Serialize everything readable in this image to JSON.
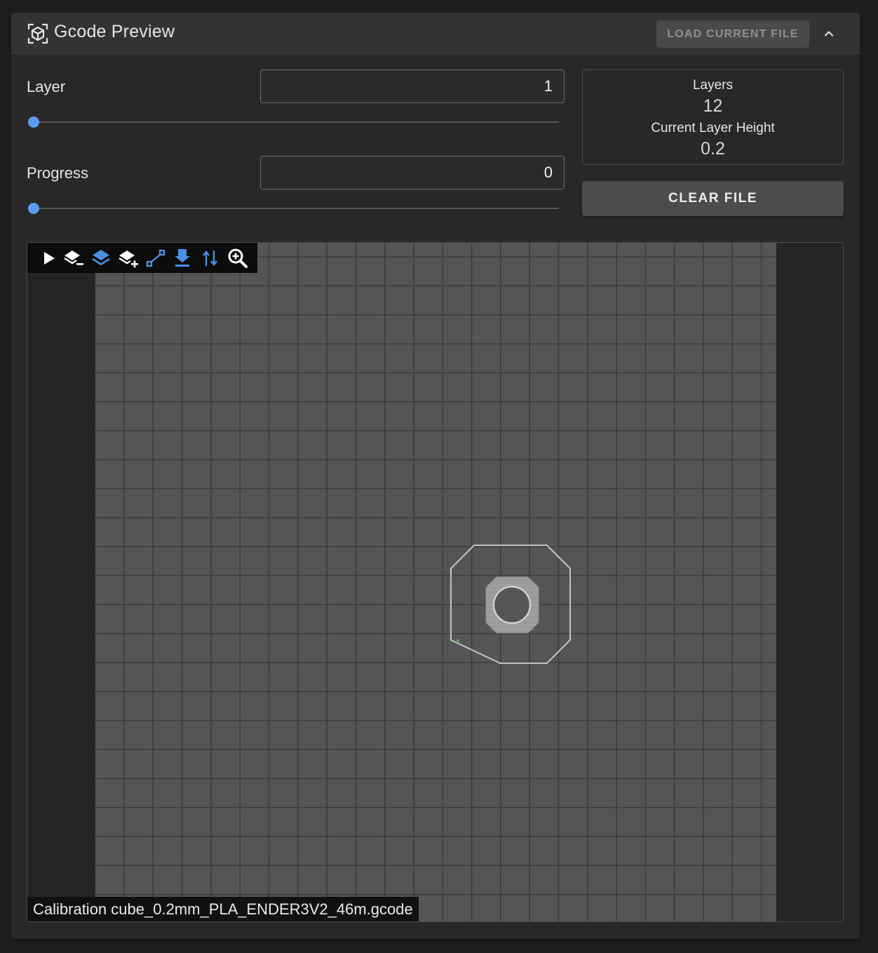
{
  "header": {
    "title": "Gcode Preview",
    "icon": "cube-scan-icon",
    "load_button": "LOAD CURRENT FILE",
    "collapse_icon": "chevron-up-icon"
  },
  "controls": {
    "layer": {
      "label": "Layer",
      "value": "1",
      "slider_fraction": 0.0
    },
    "progress": {
      "label": "Progress",
      "value": "0",
      "slider_fraction": 0.0
    }
  },
  "info": {
    "layers_label": "Layers",
    "layers_value": "12",
    "layer_height_label": "Current Layer Height",
    "layer_height_value": "0.2"
  },
  "clear_button": "CLEAR FILE",
  "toolbar": {
    "tools": [
      {
        "name": "play-icon",
        "color": "#ffffff"
      },
      {
        "name": "layer-minus-icon",
        "color": "#ffffff"
      },
      {
        "name": "layers-icon",
        "color": "#4a90e2"
      },
      {
        "name": "layer-plus-icon",
        "color": "#ffffff"
      },
      {
        "name": "travel-moves-icon",
        "color": "#4a90e2"
      },
      {
        "name": "retractions-icon",
        "color": "#4a90e2"
      },
      {
        "name": "extrusion-moves-icon",
        "color": "#4a90e2"
      },
      {
        "name": "zoom-in-icon",
        "color": "#ffffff"
      }
    ]
  },
  "viewer": {
    "file_name": "Calibration cube_0.2mm_PLA_ENDER3V2_46m.gcode",
    "bed_color": "#555555",
    "grid_color": "#3c3c3c",
    "background_color": "#252525",
    "accent_color": "#4a90e2"
  }
}
